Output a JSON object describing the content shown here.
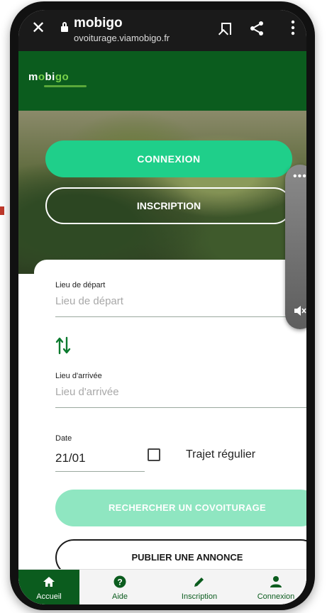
{
  "browser": {
    "title": "mobigo",
    "url": "ovoiturage.viamobigo.fr",
    "close_icon": "close-icon",
    "lock_icon": "lock-icon",
    "bookmark_icon": "bookmark-icon",
    "share_icon": "share-icon",
    "more_icon": "more-vert-icon"
  },
  "header": {
    "logo_prefix": "m",
    "logo_mid": "o",
    "logo_b": "bi",
    "logo_end": "go"
  },
  "hero": {
    "connexion_label": "CONNEXION",
    "inscription_label": "INSCRIPTION"
  },
  "form": {
    "depart_label": "Lieu de départ",
    "depart_placeholder": "Lieu de départ",
    "arrivee_label": "Lieu d'arrivée",
    "arrivee_placeholder": "Lieu d'arrivée",
    "date_label": "Date",
    "date_value": "21/01",
    "regular_label": "Trajet régulier",
    "search_label": "RECHERCHER UN COVOITURAGE",
    "publish_label": "PUBLIER UNE ANNONCE"
  },
  "nav": {
    "items": [
      {
        "label": "Accueil",
        "icon": "home-icon",
        "active": true
      },
      {
        "label": "Aide",
        "icon": "help-icon",
        "active": false
      },
      {
        "label": "Inscription",
        "icon": "pencil-icon",
        "active": false
      },
      {
        "label": "Connexion",
        "icon": "person-icon",
        "active": false
      }
    ]
  },
  "colors": {
    "brand_green": "#0b5c1e",
    "accent_mint": "#1fcf8a",
    "disabled_mint": "#8fe6c1"
  }
}
